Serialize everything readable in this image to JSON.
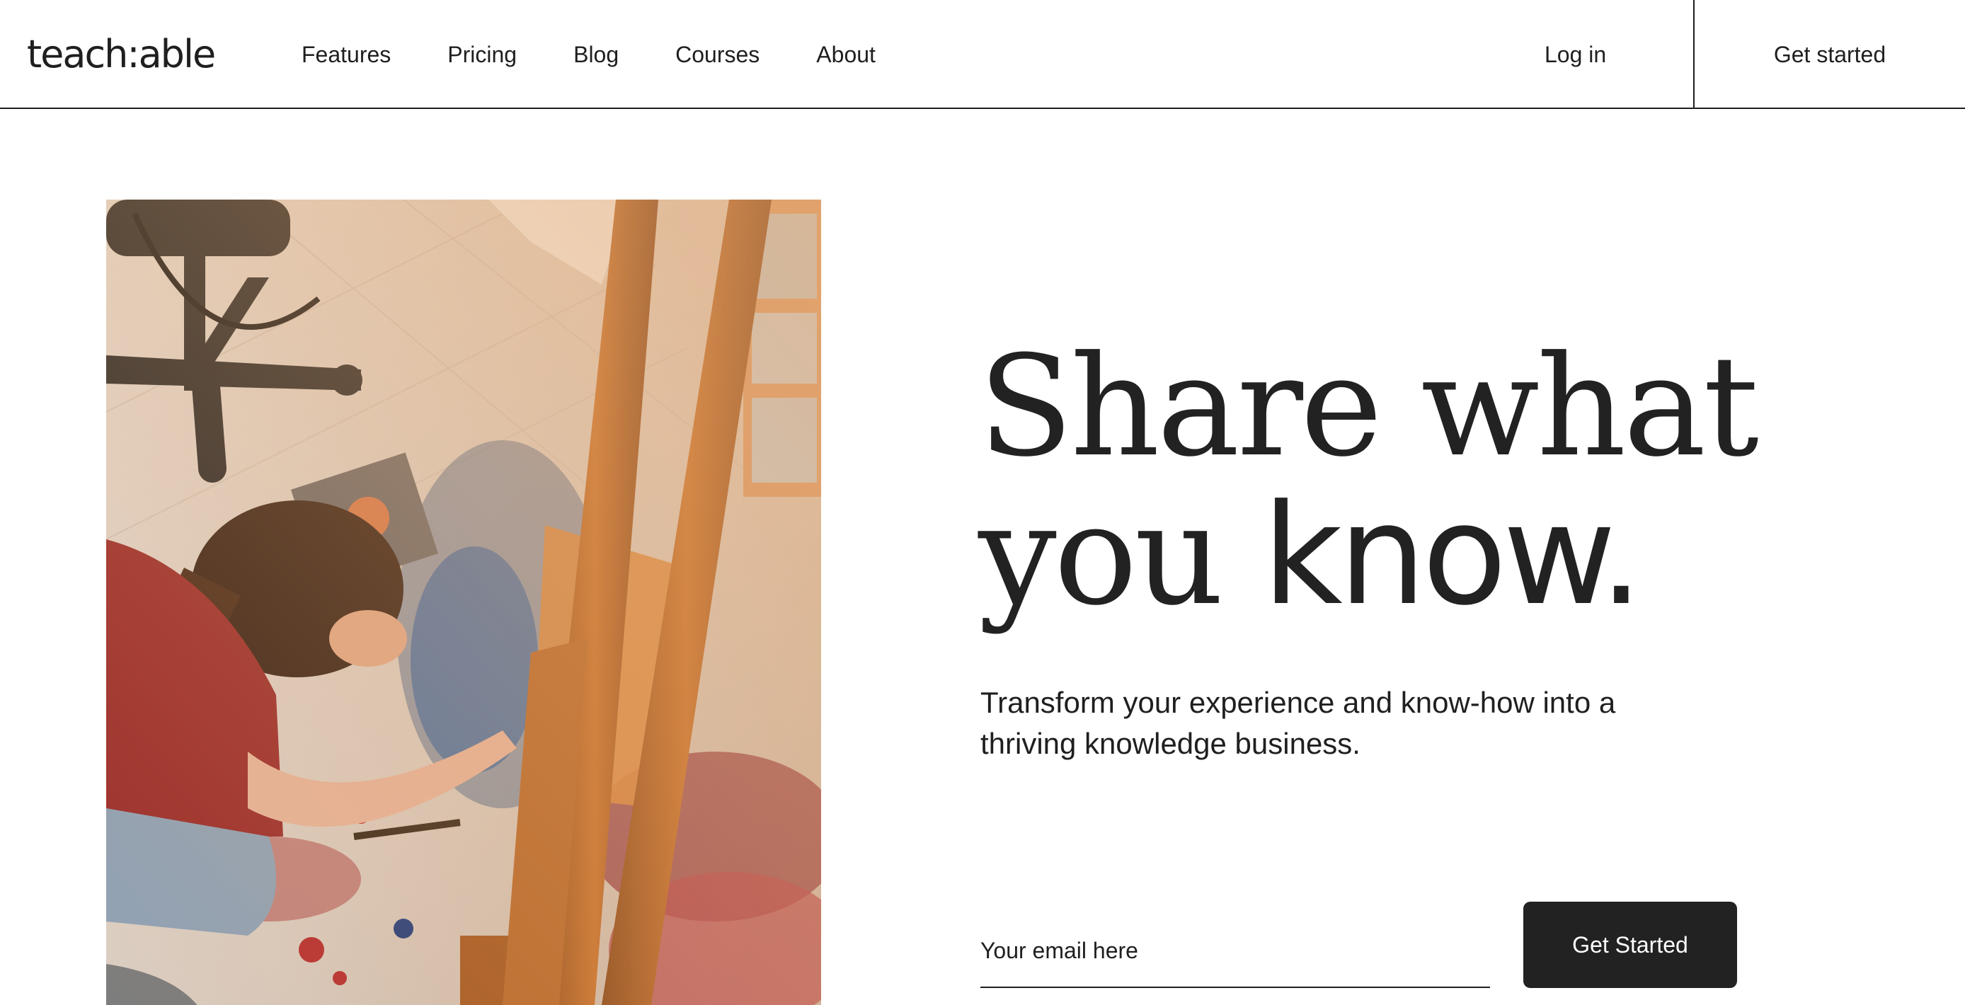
{
  "header": {
    "logo_text": "teach:able",
    "nav": {
      "features": "Features",
      "pricing": "Pricing",
      "blog": "Blog",
      "courses": "Courses",
      "about": "About"
    },
    "login_label": "Log in",
    "get_started_label": "Get started"
  },
  "hero": {
    "image_subject": "photo-artist-painting-on-studio-floor",
    "headline_line1": "Share what",
    "headline_line2_serif": "you",
    "headline_line2_emph": "know.",
    "subhead": "Transform your experience and know-how into a thriving knowledge business.",
    "email_placeholder": "Your email here",
    "cta_label": "Get Started"
  },
  "colors": {
    "text": "#1f1f1f",
    "button_bg": "#222222",
    "button_text": "#ffffff",
    "background": "#ffffff"
  }
}
